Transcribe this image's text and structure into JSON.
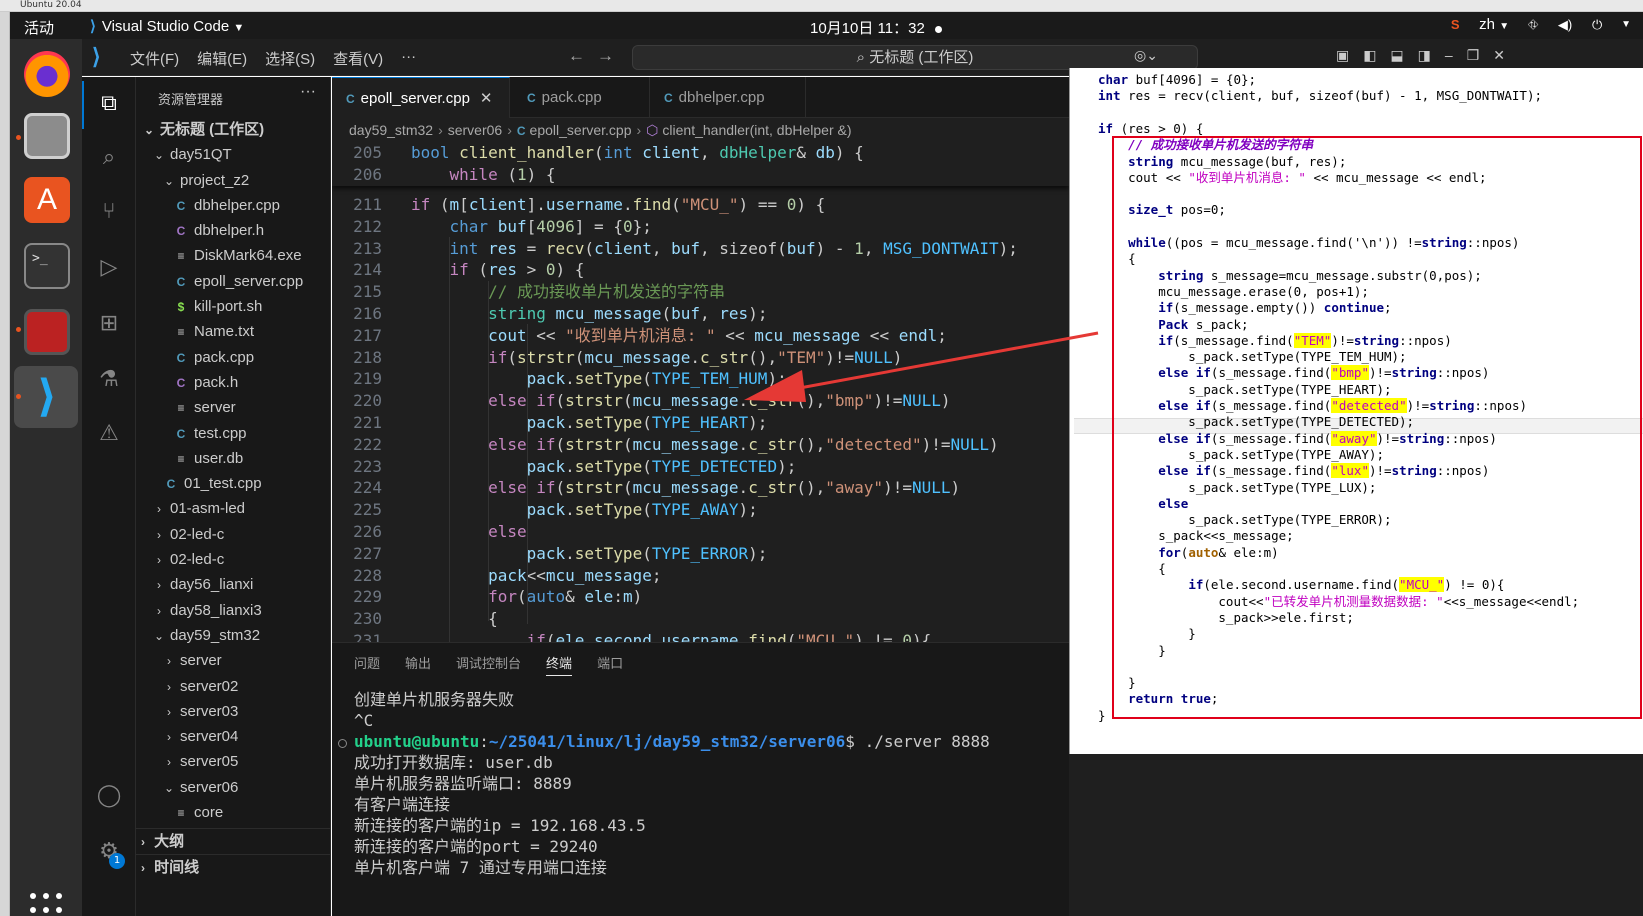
{
  "os": {
    "vm_title": "Ubuntu 20.04",
    "activities": "活动",
    "app_name": "Visual Studio Code",
    "clock": "10月10日 11：32",
    "lang": "zh"
  },
  "vscode": {
    "menu": [
      "文件(F)",
      "编辑(E)",
      "选择(S)",
      "查看(V)",
      "···"
    ],
    "search_title": "无标题 (工作区)"
  },
  "explorer": {
    "title": "资源管理器",
    "more": "···",
    "tree": [
      {
        "label": "无标题 (工作区)",
        "chev": "⌄",
        "indent": 0,
        "bold": true
      },
      {
        "label": "day51QT",
        "chev": "⌄",
        "indent": 1
      },
      {
        "label": "project_z2",
        "chev": "⌄",
        "indent": 2
      },
      {
        "label": "dbhelper.cpp",
        "icon": "C",
        "type": "cpp",
        "indent": 3
      },
      {
        "label": "dbhelper.h",
        "icon": "C",
        "type": "h",
        "indent": 3
      },
      {
        "label": "DiskMark64.exe",
        "icon": "≡",
        "type": "txt",
        "indent": 3
      },
      {
        "label": "epoll_server.cpp",
        "icon": "C",
        "type": "cpp",
        "indent": 3
      },
      {
        "label": "kill-port.sh",
        "icon": "$",
        "type": "sh",
        "indent": 3
      },
      {
        "label": "Name.txt",
        "icon": "≡",
        "type": "txt",
        "indent": 3
      },
      {
        "label": "pack.cpp",
        "icon": "C",
        "type": "cpp",
        "indent": 3
      },
      {
        "label": "pack.h",
        "icon": "C",
        "type": "h",
        "indent": 3
      },
      {
        "label": "server",
        "icon": "≡",
        "type": "txt",
        "indent": 3
      },
      {
        "label": "test.cpp",
        "icon": "C",
        "type": "cpp",
        "indent": 3
      },
      {
        "label": "user.db",
        "icon": "≡",
        "type": "txt",
        "indent": 3
      },
      {
        "label": "01_test.cpp",
        "icon": "C",
        "type": "cpp",
        "indent": 2
      },
      {
        "label": "01-asm-led",
        "chev": "›",
        "indent": 1
      },
      {
        "label": "02-led-c",
        "chev": "›",
        "indent": 1
      },
      {
        "label": "02-led-c",
        "chev": "›",
        "indent": 1
      },
      {
        "label": "day56_lianxi",
        "chev": "›",
        "indent": 1
      },
      {
        "label": "day58_lianxi3",
        "chev": "›",
        "indent": 1
      },
      {
        "label": "day59_stm32",
        "chev": "⌄",
        "indent": 1
      },
      {
        "label": "server",
        "chev": "›",
        "indent": 2
      },
      {
        "label": "server02",
        "chev": "›",
        "indent": 2
      },
      {
        "label": "server03",
        "chev": "›",
        "indent": 2
      },
      {
        "label": "server04",
        "chev": "›",
        "indent": 2
      },
      {
        "label": "server05",
        "chev": "›",
        "indent": 2
      },
      {
        "label": "server06",
        "chev": "⌄",
        "indent": 2
      },
      {
        "label": "core",
        "icon": "≡",
        "type": "txt",
        "indent": 3
      }
    ],
    "outline": "大纲",
    "timeline": "时间线"
  },
  "tabs": [
    {
      "label": "epoll_server.cpp",
      "active": true
    },
    {
      "label": "pack.cpp",
      "active": false
    },
    {
      "label": "dbhelper.cpp",
      "active": false
    }
  ],
  "breadcrumb": [
    "day59_stm32",
    "server06",
    "epoll_server.cpp",
    "client_handler(int, dbHelper &)"
  ],
  "code": {
    "sticky": [
      {
        "n": "205",
        "t": "bool client_handler(int client, dbHelper& db) {"
      },
      {
        "n": "206",
        "t": "    while (1) {"
      }
    ],
    "lines": [
      {
        "n": "211",
        "t": "if (m[client].username.find(\"MCU_\") == 0) {"
      },
      {
        "n": "212",
        "t": "    char buf[4096] = {0};"
      },
      {
        "n": "213",
        "t": "    int res = recv(client, buf, sizeof(buf) - 1, MSG_DONTWAIT);"
      },
      {
        "n": "214",
        "t": "    if (res > 0) {"
      },
      {
        "n": "215",
        "t": "        // 成功接收单片机发送的字符串"
      },
      {
        "n": "216",
        "t": "        string mcu_message(buf, res);"
      },
      {
        "n": "217",
        "t": "        cout << \"收到单片机消息: \" << mcu_message << endl;"
      },
      {
        "n": "218",
        "t": "        if(strstr(mcu_message.c_str(),\"TEM\")!=NULL)"
      },
      {
        "n": "219",
        "t": "            pack.setType(TYPE_TEM_HUM);"
      },
      {
        "n": "220",
        "t": "        else if(strstr(mcu_message.c_str(),\"bmp\")!=NULL)"
      },
      {
        "n": "221",
        "t": "            pack.setType(TYPE_HEART);"
      },
      {
        "n": "222",
        "t": "        else if(strstr(mcu_message.c_str(),\"detected\")!=NULL)"
      },
      {
        "n": "223",
        "t": "            pack.setType(TYPE_DETECTED);"
      },
      {
        "n": "224",
        "t": "        else if(strstr(mcu_message.c_str(),\"away\")!=NULL)"
      },
      {
        "n": "225",
        "t": "            pack.setType(TYPE_AWAY);"
      },
      {
        "n": "226",
        "t": "        else"
      },
      {
        "n": "227",
        "t": "            pack.setType(TYPE_ERROR);"
      },
      {
        "n": "228",
        "t": "        pack<<mcu_message;"
      },
      {
        "n": "229",
        "t": "        for(auto& ele:m)"
      },
      {
        "n": "230",
        "t": "        {"
      },
      {
        "n": "231",
        "t": "            if(ele.second.username.find(\"MCU_\") != 0){"
      }
    ]
  },
  "panel": {
    "tabs": [
      "问题",
      "输出",
      "调试控制台",
      "终端",
      "端口"
    ],
    "active_tab": "终端",
    "terminal": [
      {
        "t": "创建单片机服务器失败"
      },
      {
        "t": "^C"
      },
      {
        "prompt_user": "ubuntu@ubuntu",
        "prompt_path": "~/25041/linux/lj/day59_stm32/server06",
        "cmd": "$ ./server 8888"
      },
      {
        "t": "成功打开数据库: user.db"
      },
      {
        "t": "单片机服务器监听端口: 8889"
      },
      {
        "t": "有客户端连接"
      },
      {
        "t": "新连接的客户端的ip = 192.168.43.5"
      },
      {
        "t": "新连接的客户端的port = 29240"
      },
      {
        "t": "单片机客户端 7 通过专用端口连接"
      }
    ]
  },
  "overlay": {
    "lines": [
      "char buf[4096] = {0};",
      "int res = recv(client, buf, sizeof(buf) - 1, MSG_DONTWAIT);",
      "",
      "if (res > 0) {",
      "    // 成功接收单片机发送的字符串",
      "    string mcu_message(buf, res);",
      "    cout << \"收到单片机消息: \" << mcu_message << endl;",
      "",
      "    size_t pos=0;",
      "",
      "    while((pos = mcu_message.find('\\n')) !=string::npos)",
      "    {",
      "        string s_message=mcu_message.substr(0,pos);",
      "        mcu_message.erase(0, pos+1);",
      "        if(s_message.empty()) continue;",
      "        Pack s_pack;",
      "        if(s_message.find(\"TEM\")!=string::npos)",
      "            s_pack.setType(TYPE_TEM_HUM);",
      "        else if(s_message.find(\"bmp\")!=string::npos)",
      "            s_pack.setType(TYPE_HEART);",
      "        else if(s_message.find(\"detected\")!=string::npos)",
      "            s_pack.setType(TYPE_DETECTED);",
      "        else if(s_message.find(\"away\")!=string::npos)",
      "            s_pack.setType(TYPE_AWAY);",
      "        else if(s_message.find(\"lux\")!=string::npos)",
      "            s_pack.setType(TYPE_LUX);",
      "        else",
      "            s_pack.setType(TYPE_ERROR);",
      "        s_pack<<s_message;",
      "        for(auto& ele:m)",
      "        {",
      "            if(ele.second.username.find(\"MCU_\") != 0){",
      "                cout<<\"已转发单片机测量数据数据: \"<<s_message<<endl;",
      "                s_pack>>ele.first;",
      "            }",
      "        }",
      "",
      "    }",
      "    return true;",
      "}"
    ]
  },
  "colors": {
    "accent": "#0078d4",
    "editor_bg": "#1f1f1f",
    "sidebar_bg": "#181818",
    "arrow": "#e53935",
    "highlight_box": "#e0001a"
  }
}
